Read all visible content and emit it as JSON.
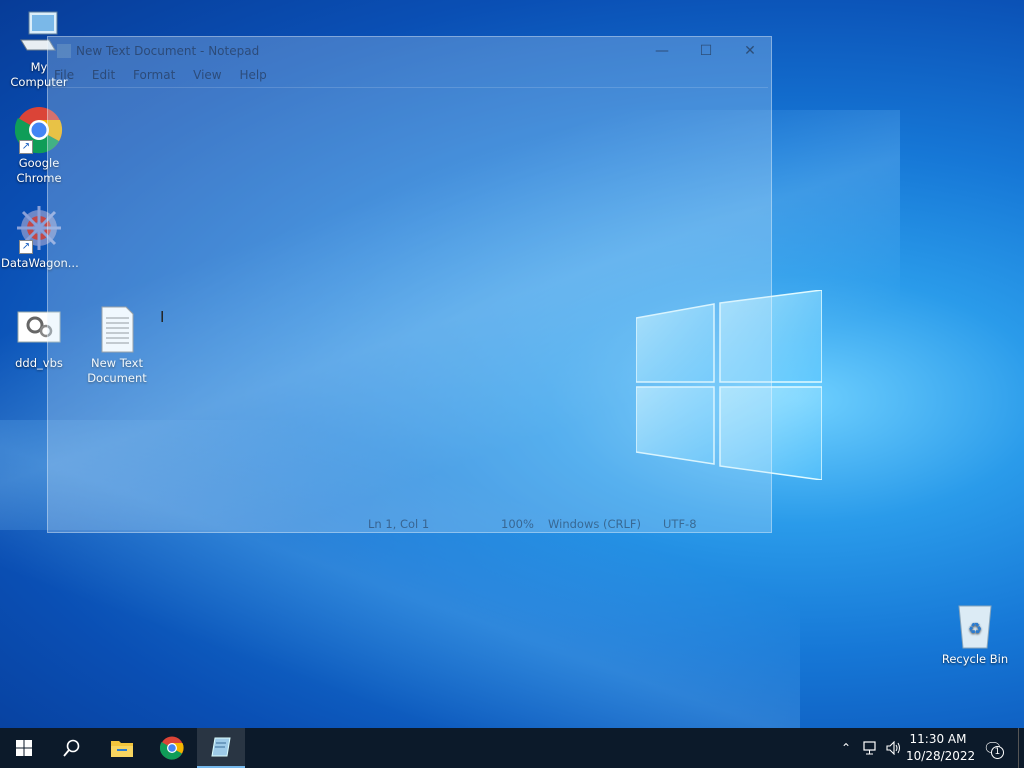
{
  "desktop": {
    "icons": [
      {
        "label": "My Computer"
      },
      {
        "label": "Google Chrome"
      },
      {
        "label": "DataWagon..."
      },
      {
        "label": "ddd_vbs"
      },
      {
        "label": "New Text Document"
      },
      {
        "label": "Recycle Bin"
      }
    ]
  },
  "notepad": {
    "title": "New Text Document - Notepad",
    "menu": [
      "File",
      "Edit",
      "Format",
      "View",
      "Help"
    ],
    "status": {
      "position": "Ln 1, Col 1",
      "zoom": "100%",
      "line_endings": "Windows (CRLF)",
      "encoding": "UTF-8"
    }
  },
  "taskbar": {
    "clock_time": "11:30 AM",
    "clock_date": "10/28/2022",
    "notification_count": "1"
  },
  "colors": {
    "taskbar": "#0c1a2a",
    "accent": "#76b9ed",
    "desktop_blue": "#1677d6"
  }
}
